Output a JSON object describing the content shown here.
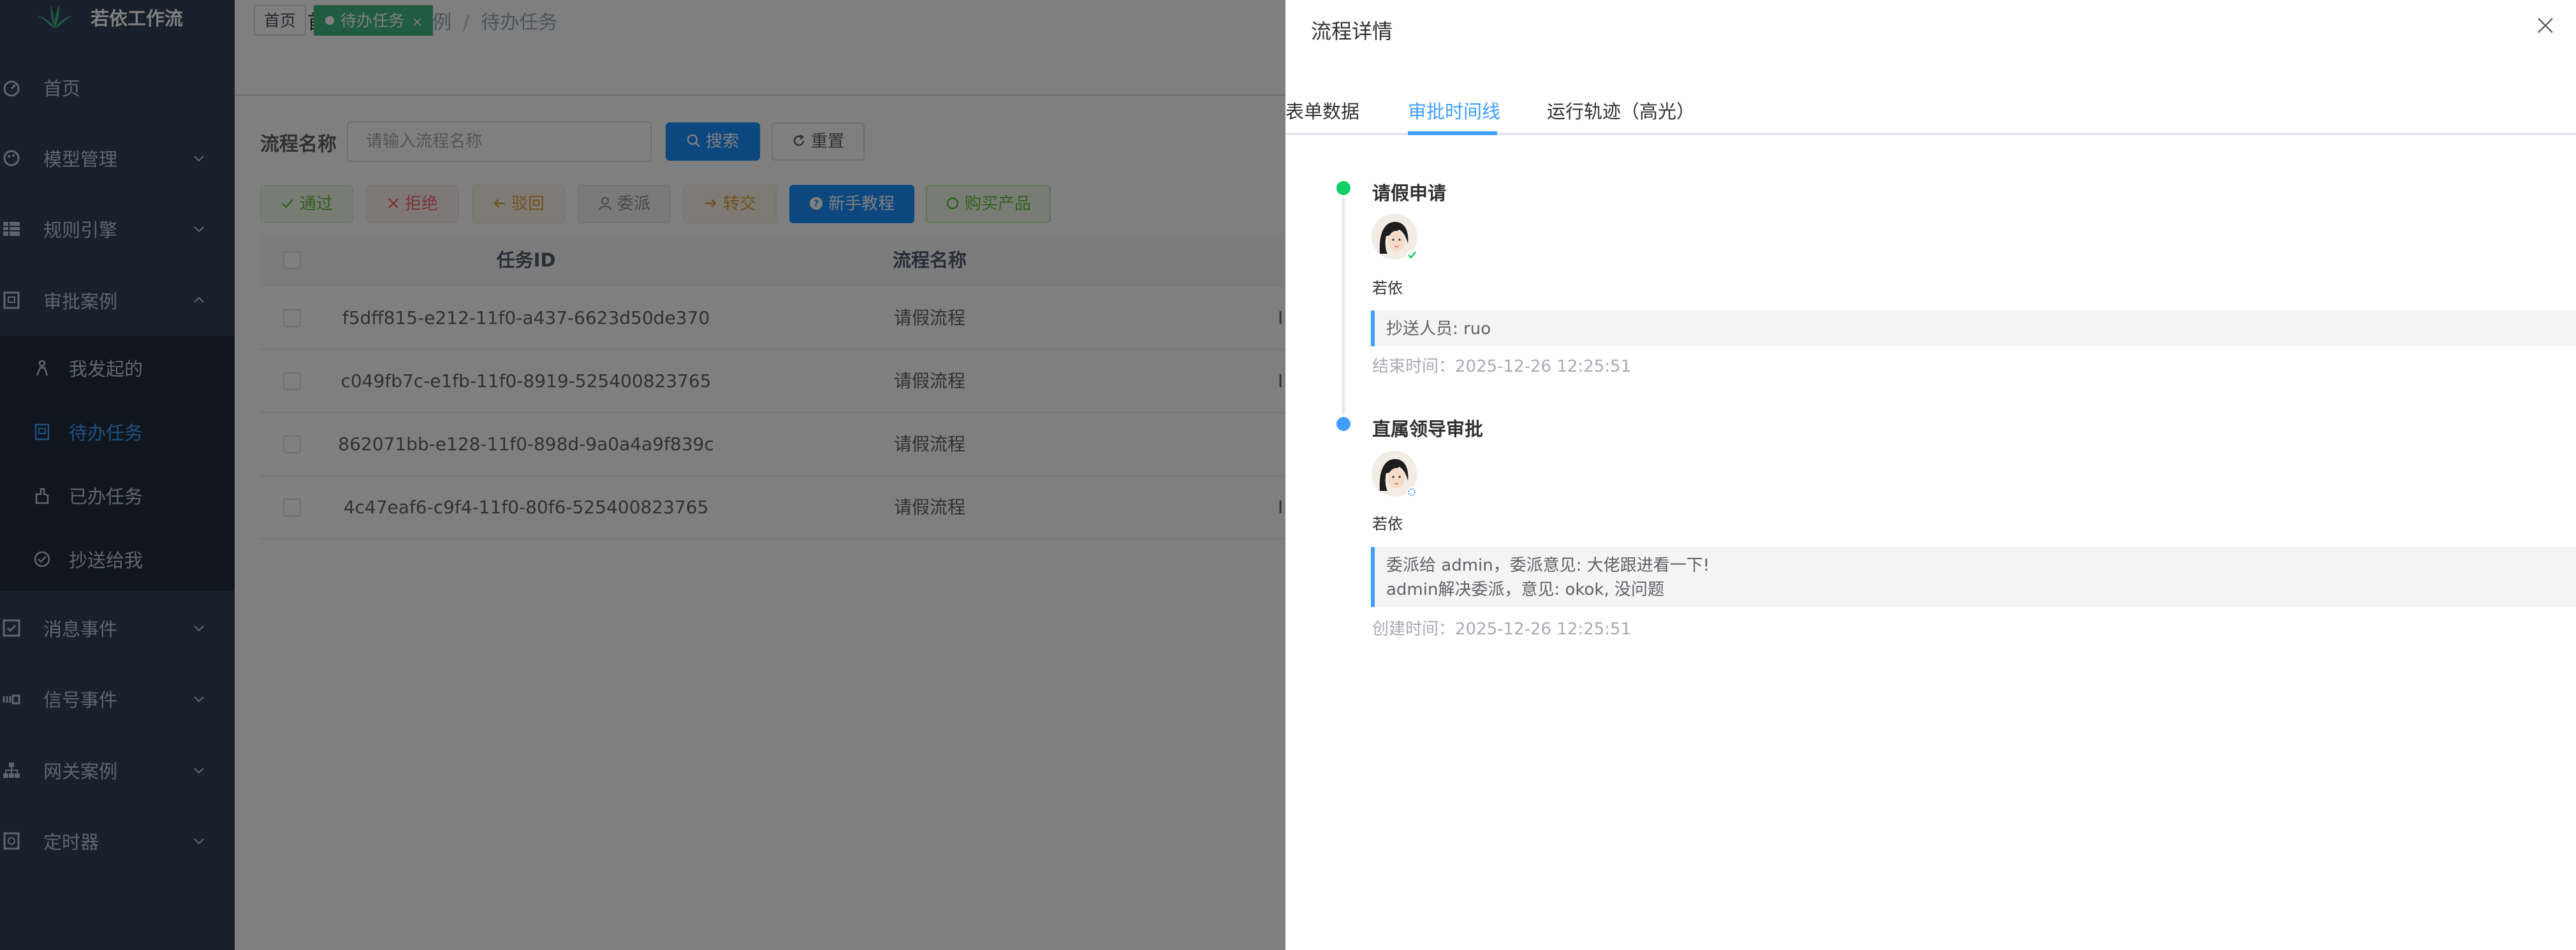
{
  "app": {
    "title": "若依工作流"
  },
  "sidebar": {
    "items": [
      {
        "label": "首页",
        "icon": "dashboard-icon"
      },
      {
        "label": "模型管理",
        "icon": "palette-icon"
      },
      {
        "label": "规则引擎",
        "icon": "table-icon"
      },
      {
        "label": "审批案例",
        "icon": "form-icon"
      },
      {
        "label": "消息事件",
        "icon": "checkbox-icon"
      },
      {
        "label": "信号事件",
        "icon": "signal-icon"
      },
      {
        "label": "网关案例",
        "icon": "tree-icon"
      },
      {
        "label": "定时器",
        "icon": "timer-icon"
      }
    ],
    "submenu": [
      {
        "label": "我发起的",
        "icon": "user-icon"
      },
      {
        "label": "待办任务",
        "icon": "clipboard-icon",
        "active": true
      },
      {
        "label": "已办任务",
        "icon": "hand-icon"
      },
      {
        "label": "抄送给我",
        "icon": "check-circle-icon"
      }
    ]
  },
  "breadcrumb": [
    "首页",
    "审批案例",
    "待办任务"
  ],
  "tags": {
    "home": "首页",
    "todo": "待办任务",
    "close": "×"
  },
  "query": {
    "label": "流程名称",
    "placeholder": "请输入流程名称",
    "search": "搜索",
    "reset": "重置"
  },
  "toolbar": {
    "pass": "通过",
    "reject": "拒绝",
    "return": "驳回",
    "delegate": "委派",
    "transfer": "转交",
    "tutorial": "新手教程",
    "buy": "购买产品"
  },
  "table": {
    "columns": [
      "任务ID",
      "流程名称"
    ],
    "rows": [
      {
        "id": "f5dff815-e212-11f0-a437-6623d50de370",
        "name": "请假流程",
        "extra": "I"
      },
      {
        "id": "c049fb7c-e1fb-11f0-8919-525400823765",
        "name": "请假流程",
        "extra": "I"
      },
      {
        "id": "862071bb-e128-11f0-898d-9a0a4a9f839c",
        "name": "请假流程",
        "extra": ""
      },
      {
        "id": "4c47eaf6-c9f4-11f0-80f6-525400823765",
        "name": "请假流程",
        "extra": "I"
      }
    ]
  },
  "drawer": {
    "title": "流程详情",
    "tabs": [
      "表单数据",
      "审批时间线",
      "运行轨迹（高光）"
    ],
    "active_tab": "审批时间线",
    "timeline": [
      {
        "title": "请假申请",
        "user": "若依",
        "note_lines": [
          "抄送人员: ruo"
        ],
        "time": "结束时间：2025-12-26 12:25:51",
        "dot_color": "#13ce66",
        "status": "completed"
      },
      {
        "title": "直属领导审批",
        "user": "若依",
        "note_lines": [
          "委派给 admin，委派意见: 大佬跟进看一下!",
          "admin解决委派，意见: okok, 没问题"
        ],
        "time": "创建时间：2025-12-26 12:25:51",
        "dot_color": "#409eff",
        "status": "pending"
      }
    ]
  },
  "colors": {
    "sidebar": "#304156",
    "submenu": "#1f2d3d",
    "primary": "#1890ff",
    "active": "#409eff",
    "success": "#13ce66"
  }
}
